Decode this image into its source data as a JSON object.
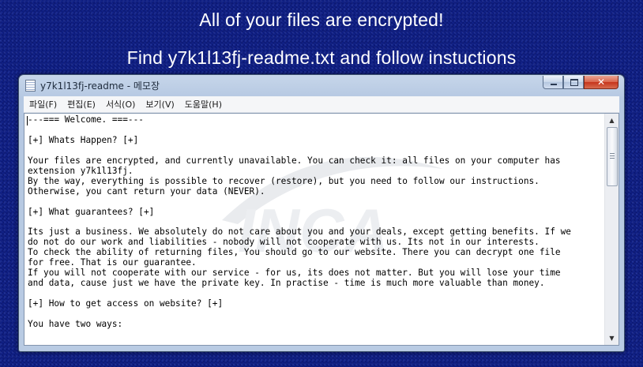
{
  "banner": {
    "line1": "All of your files are encrypted!",
    "line2": "Find y7k1l13fj-readme.txt and follow instuctions"
  },
  "window": {
    "title": "y7k1l13fj-readme - 메모장",
    "icon": "notepad-icon",
    "controls": {
      "minimize": "minimize-icon",
      "maximize": "maximize-icon",
      "close": "close-icon"
    }
  },
  "menu": {
    "items": [
      {
        "label": "파일(F)"
      },
      {
        "label": "편집(E)"
      },
      {
        "label": "서식(O)"
      },
      {
        "label": "보기(V)"
      },
      {
        "label": "도움말(H)"
      }
    ]
  },
  "document": {
    "text": "---=== Welcome. ===---\n\n[+] Whats Happen? [+]\n\nYour files are encrypted, and currently unavailable. You can check it: all files on your computer has\nextension y7k1l13fj.\nBy the way, everything is possible to recover (restore), but you need to follow our instructions.\nOtherwise, you cant return your data (NEVER).\n\n[+] What guarantees? [+]\n\nIts just a business. We absolutely do not care about you and your deals, except getting benefits. If we\ndo not do our work and liabilities - nobody will not cooperate with us. Its not in our interests.\nTo check the ability of returning files, You should go to our website. There you can decrypt one file\nfor free. That is our guarantee.\nIf you will not cooperate with our service - for us, its does not matter. But you will lose your time\nand data, cause just we have the private key. In practise - time is much more valuable than money.\n\n[+] How to get access on website? [+]\n\nYou have two ways:",
    "watermark": "INCA"
  },
  "scrollbar": {
    "up_icon": "scroll-up-arrow-icon",
    "down_icon": "scroll-down-arrow-icon"
  }
}
